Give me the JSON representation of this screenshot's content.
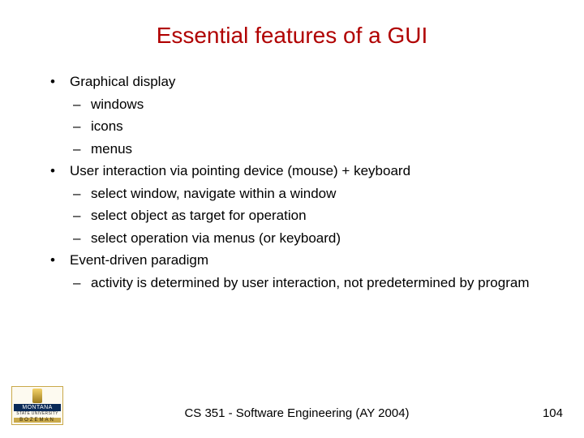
{
  "title": "Essential features of a GUI",
  "bullets": [
    {
      "text": "Graphical display",
      "sub": [
        "windows",
        "icons",
        "menus"
      ]
    },
    {
      "text": "User interaction via pointing device (mouse) + keyboard",
      "sub": [
        "select window, navigate within a window",
        "select object as target for operation",
        "select operation via menus (or keyboard)"
      ]
    },
    {
      "text": "Event-driven paradigm",
      "sub": [
        "activity is determined by user interaction, not predetermined by program"
      ]
    }
  ],
  "logo": {
    "line1": "MONTANA",
    "line2": "STATE UNIVERSITY",
    "line3": "BOZEMAN"
  },
  "footer": {
    "center": "CS 351 - Software Engineering (AY 2004)",
    "page": "104"
  }
}
